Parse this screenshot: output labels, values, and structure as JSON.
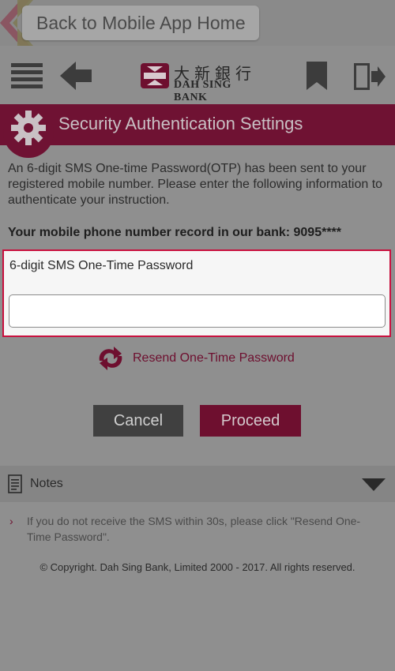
{
  "back_bar": {
    "label": "Back to Mobile App Home"
  },
  "header": {
    "logo": {
      "chinese": "大新銀行",
      "english": "DAH SING BANK"
    },
    "icons": [
      "menu-icon",
      "back-arrow-icon",
      "bookmark-icon",
      "logout-icon"
    ]
  },
  "title": {
    "text": "Security Authentication Settings",
    "icon": "gear-icon"
  },
  "intro": "An 6-digit SMS One-time Password(OTP) has been sent to your registered mobile number. Please enter the following information to authenticate your instruction.",
  "phone_record": "Your mobile phone number record in our bank: 9095****",
  "otp": {
    "label": "6-digit SMS One-Time Password",
    "value": "",
    "placeholder": ""
  },
  "resend": {
    "label": "Resend One-Time Password",
    "icon": "refresh-icon"
  },
  "actions": {
    "cancel": "Cancel",
    "proceed": "Proceed"
  },
  "notes": {
    "title": "Notes",
    "items": [
      "If you do not receive the SMS within 30s, please click \"Resend One-Time Password\"."
    ]
  },
  "copyright": "© Copyright. Dah Sing Bank, Limited 2000 - 2017. All rights reserved.",
  "colors": {
    "brand": "#6e0f2f",
    "highlight_border": "#c8103e",
    "overlay_bg": "#8f8f8f"
  }
}
